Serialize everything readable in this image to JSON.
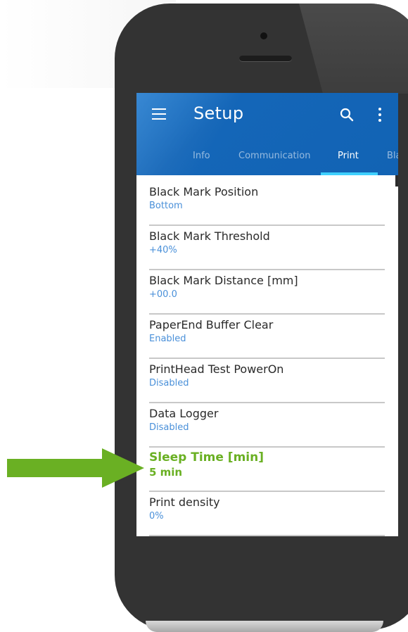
{
  "app": {
    "title": "Setup",
    "icons": {
      "menu": "menu-icon",
      "search": "search-icon",
      "more": "more-vert-icon"
    }
  },
  "tabs": [
    {
      "label": "Info",
      "active": false
    },
    {
      "label": "Communication",
      "active": false
    },
    {
      "label": "Print",
      "active": true
    },
    {
      "label": "Bla",
      "active": false
    }
  ],
  "settings": [
    {
      "title": "Black Mark Position",
      "value": "Bottom"
    },
    {
      "title": "Black Mark Threshold",
      "value": "+40%"
    },
    {
      "title": "Black Mark Distance [mm]",
      "value": "+00.0"
    },
    {
      "title": "PaperEnd Buffer Clear",
      "value": "Enabled"
    },
    {
      "title": "PrintHead Test PowerOn",
      "value": "Disabled"
    },
    {
      "title": "Data Logger",
      "value": "Disabled"
    },
    {
      "title": "Sleep Time [min]",
      "value": "5 min",
      "highlighted": true
    },
    {
      "title": "Print density",
      "value": "0%"
    }
  ],
  "colors": {
    "appbar": "#1466b8",
    "tab_indicator": "#3fd0ff",
    "setting_value": "#4a90d9",
    "highlight": "#6ab023",
    "arrow": "#6ab023",
    "phone_body": "#333333"
  }
}
